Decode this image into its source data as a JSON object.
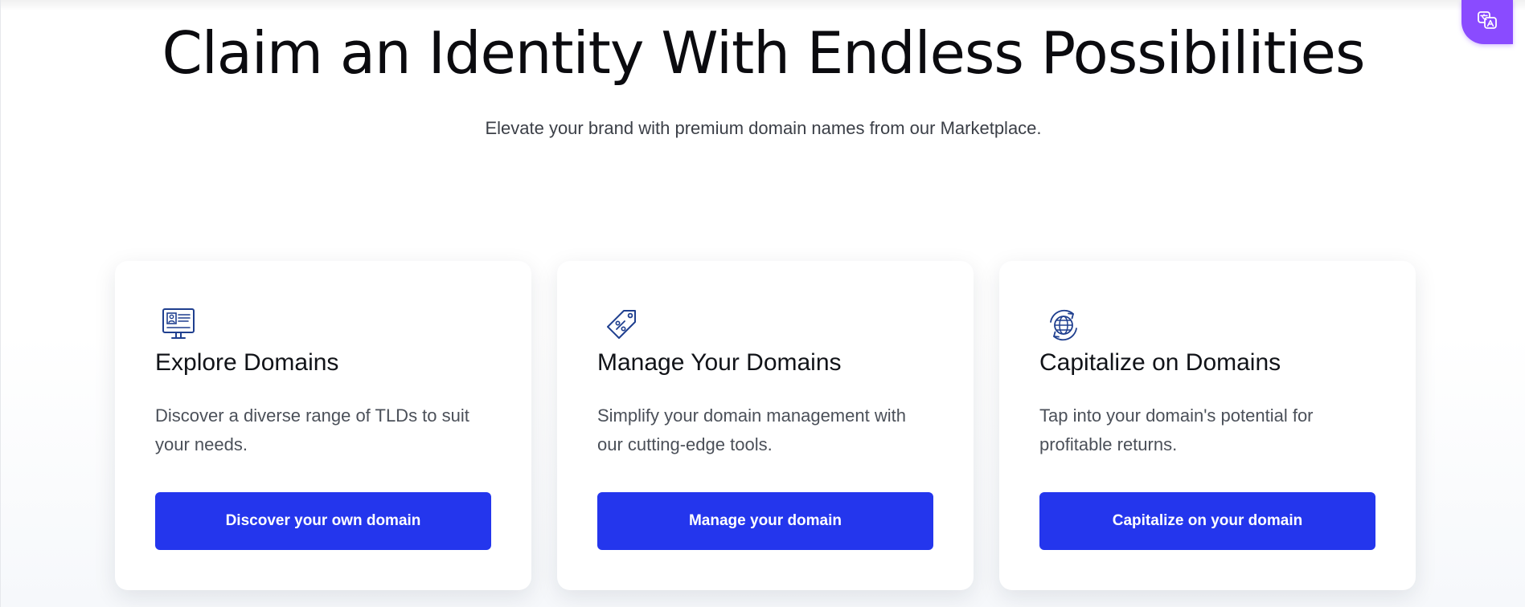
{
  "hero": {
    "title": "Claim an Identity With Endless Possibilities",
    "subtitle": "Elevate your brand with premium domain names from our Marketplace."
  },
  "translate_widget": {
    "icon": "translate-icon",
    "color": "#8a4bff"
  },
  "cards": [
    {
      "icon": "monitor-profile-icon",
      "title": "Explore Domains",
      "description": "Discover a diverse range of TLDs to suit your needs.",
      "button_label": "Discover your own domain"
    },
    {
      "icon": "price-tag-icon",
      "title": "Manage Your Domains",
      "description": "Simplify your domain management with our cutting-edge tools.",
      "button_label": "Manage your domain"
    },
    {
      "icon": "globe-cycle-icon",
      "title": "Capitalize on Domains",
      "description": "Tap into your domain's potential for profitable returns.",
      "button_label": "Capitalize on your domain"
    }
  ],
  "colors": {
    "button": "#2436ed",
    "icon": "#1f3f8f",
    "heading": "#0b0b0f"
  }
}
